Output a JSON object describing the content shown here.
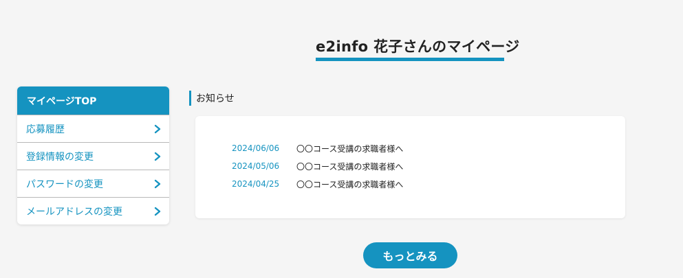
{
  "header": {
    "title": "e2info 花子さんのマイページ"
  },
  "sidebar": {
    "top_label": "マイページTOP",
    "items": [
      {
        "label": "応募履歴"
      },
      {
        "label": "登録情報の変更"
      },
      {
        "label": "パスワードの変更"
      },
      {
        "label": "メールアドレスの変更"
      }
    ]
  },
  "notices": {
    "heading": "お知らせ",
    "items": [
      {
        "date": "2024/06/06",
        "text": "〇〇コース受講の求職者様へ"
      },
      {
        "date": "2024/05/06",
        "text": "〇〇コース受講の求職者様へ"
      },
      {
        "date": "2024/04/25",
        "text": "〇〇コース受講の求職者様へ"
      }
    ],
    "more_label": "もっとみる"
  },
  "icons": {
    "sidebar_arrow": "chevron-right-icon"
  },
  "colors": {
    "accent": "#1593c0",
    "background": "#f5f5f5",
    "card": "#ffffff",
    "text": "#222222"
  }
}
